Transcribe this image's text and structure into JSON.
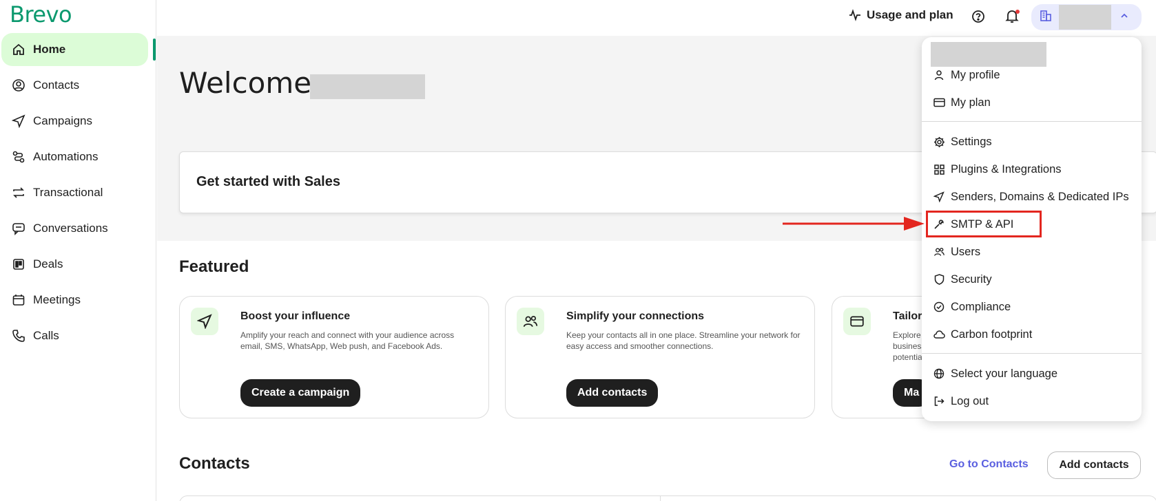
{
  "app": {
    "logo": "Brevo"
  },
  "sidebar": {
    "items": [
      {
        "label": "Home",
        "icon": "home-icon",
        "active": true
      },
      {
        "label": "Contacts",
        "icon": "contacts-icon"
      },
      {
        "label": "Campaigns",
        "icon": "send-icon"
      },
      {
        "label": "Automations",
        "icon": "automation-icon"
      },
      {
        "label": "Transactional",
        "icon": "repeat-icon"
      },
      {
        "label": "Conversations",
        "icon": "chat-icon"
      },
      {
        "label": "Deals",
        "icon": "kanban-icon"
      },
      {
        "label": "Meetings",
        "icon": "calendar-icon"
      },
      {
        "label": "Calls",
        "icon": "phone-icon"
      }
    ]
  },
  "header": {
    "usage_label": "Usage and plan"
  },
  "main": {
    "welcome": "Welcome",
    "get_started": "Get started with Sales",
    "featured_title": "Featured",
    "featured": [
      {
        "title": "Boost your influence",
        "desc": "Amplify your reach and connect with your audience across email, SMS, WhatsApp, Web push, and Facebook Ads.",
        "button": "Create a campaign",
        "icon": "send-icon"
      },
      {
        "title": "Simplify your connections",
        "desc": "Keep your contacts all in one place. Streamline your network for easy access and smoother connections.",
        "button": "Add contacts",
        "icon": "users-icon"
      },
      {
        "title": "Tailor",
        "desc": "Explore business potentia",
        "button": "Ma",
        "icon": "card-icon"
      }
    ],
    "contacts_title": "Contacts",
    "goto_contacts": "Go to Contacts",
    "add_contacts": "Add contacts"
  },
  "dropdown": {
    "items": [
      {
        "label": "My profile",
        "icon": "user-icon"
      },
      {
        "label": "My plan",
        "icon": "card-icon"
      },
      {
        "label": "Settings",
        "icon": "gear-icon"
      },
      {
        "label": "Plugins & Integrations",
        "icon": "grid-icon"
      },
      {
        "label": "Senders, Domains & Dedicated IPs",
        "icon": "send-icon"
      },
      {
        "label": "SMTP & API",
        "icon": "wrench-icon",
        "highlighted": true
      },
      {
        "label": "Users",
        "icon": "users-icon"
      },
      {
        "label": "Security",
        "icon": "shield-icon"
      },
      {
        "label": "Compliance",
        "icon": "check-circle-icon"
      },
      {
        "label": "Carbon footprint",
        "icon": "cloud-icon"
      },
      {
        "label": "Select your language",
        "icon": "globe-icon"
      },
      {
        "label": "Log out",
        "icon": "logout-icon"
      }
    ]
  },
  "colors": {
    "brand": "#0b996e",
    "active_nav_bg": "#dcfcd7",
    "link": "#5a5fe0",
    "annotation": "#e3261f"
  }
}
